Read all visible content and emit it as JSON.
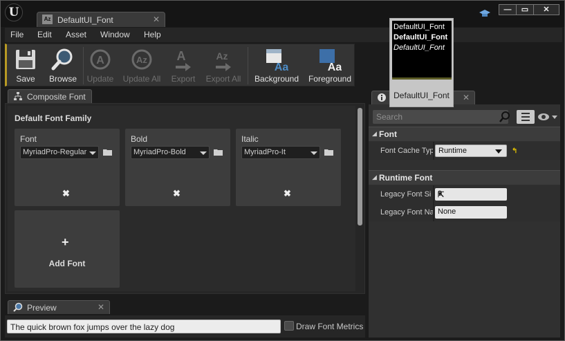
{
  "window": {
    "tab_title": "DefaultUI_Font",
    "tab_icon_text": "Az",
    "minimize_label": "—",
    "maximize_label": "▭",
    "close_label": "✕"
  },
  "menu": [
    "File",
    "Edit",
    "Asset",
    "Window",
    "Help"
  ],
  "toolbar": {
    "save": "Save",
    "browse": "Browse",
    "update": "Update",
    "update_all": "Update All",
    "export": "Export",
    "export_all": "Export All",
    "background": "Background",
    "foreground": "Foreground"
  },
  "composite_tab": {
    "title": "Composite Font",
    "close": "✕"
  },
  "font_family": {
    "title": "Default Font Family",
    "slots": [
      {
        "label": "Font",
        "value": "MyriadPro-Regular"
      },
      {
        "label": "Bold",
        "value": "MyriadPro-Bold"
      },
      {
        "label": "Italic",
        "value": "MyriadPro-It"
      }
    ],
    "remove_symbol": "✖",
    "add_symbol": "+",
    "add_label": "Add Font"
  },
  "preview_tab": {
    "title": "Preview",
    "close": "✕"
  },
  "preview": {
    "text": "The quick brown fox jumps over the lazy dog",
    "draw_metrics_label": "Draw Font Metrics"
  },
  "details_tab": {
    "close": "✕"
  },
  "details": {
    "search_placeholder": "Search",
    "font_category": "Font",
    "font_cache_label": "Font Cache Typ",
    "font_cache_value": "Runtime",
    "reset_symbol": "↰",
    "runtime_category": "Runtime Font",
    "legacy_size_label": "Legacy Font Si",
    "legacy_size_value": "9",
    "legacy_name_label": "Legacy Font Na",
    "legacy_name_value": "None"
  },
  "tooltip": {
    "line_regular": "DefaultUI_Font",
    "line_bold": "DefaultUI_Font",
    "line_italic": "DefaultUI_Font",
    "name": "DefaultUI_Font"
  },
  "colors": {
    "toolbar_accent": "#b89a23",
    "reset_arrow": "#e3c200",
    "eye_icon": "#6fa7e0"
  }
}
